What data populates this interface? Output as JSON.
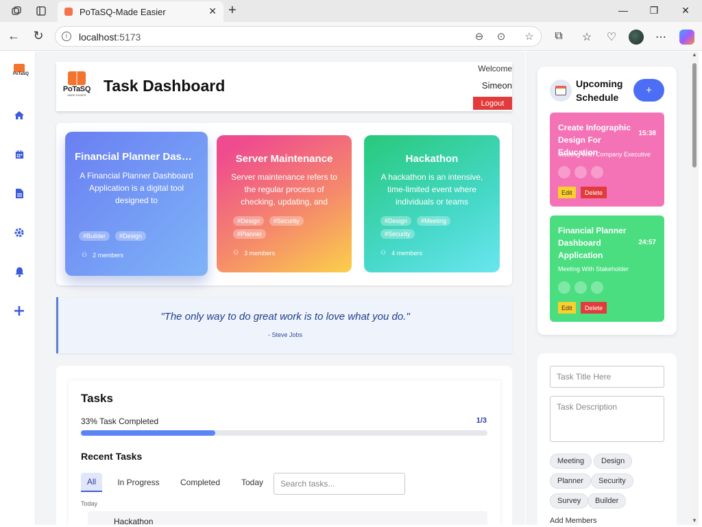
{
  "browser": {
    "tab_title": "PoTaSQ-Made Easier",
    "url_host": "localhost",
    "url_port": ":5173"
  },
  "header": {
    "logo_name": "PoTaSQ",
    "logo_tagline": "MADE EASIER",
    "title": "Task Dashboard",
    "welcome": "Welcome",
    "username": "Simeon",
    "logout_label": "Logout"
  },
  "projects": [
    {
      "title": "Financial Planner Dashboard Application",
      "description": "A Financial Planner Dashboard Application is a digital tool designed to",
      "tags": [
        "#Builder",
        "#Design"
      ],
      "members": "2 members"
    },
    {
      "title": "Server Maintenance",
      "description": "Server maintenance refers to the regular process of checking, updating, and",
      "tags": [
        "#Design",
        "#Security",
        "#Planner"
      ],
      "members": "3 members"
    },
    {
      "title": "Hackathon",
      "description": "A hackathon is an intensive, time-limited event where individuals or teams",
      "tags": [
        "#Design",
        "#Meeting",
        "#Security"
      ],
      "members": "4 members"
    }
  ],
  "quote": {
    "text": "\"The only way to do great work is to love what you do.\"",
    "author": "- Steve Jobs"
  },
  "tasks": {
    "title": "Tasks",
    "progress_label": "33% Task Completed",
    "progress_fraction": 0.33,
    "progress_count": "1/3",
    "recent_title": "Recent Tasks",
    "filters": [
      "All",
      "In Progress",
      "Completed",
      "Today"
    ],
    "active_filter": "All",
    "search_placeholder": "Search tasks...",
    "group_label": "Today",
    "rows": [
      {
        "title": "Hackathon"
      }
    ]
  },
  "schedule": {
    "title": "Upcoming Schedule",
    "add_label": "+",
    "items": [
      {
        "title": "Create Infographic Design For Education",
        "time": "15:38",
        "subtitle": "Meeting With Company Executive",
        "edit_label": "Edit",
        "delete_label": "Delete",
        "color": "#f472b6"
      },
      {
        "title": "Financial Planner Dashboard Application",
        "time": "24:57",
        "subtitle": "Meeting With Stakeholder",
        "edit_label": "Edit",
        "delete_label": "Delete",
        "color": "#4ade80"
      }
    ]
  },
  "task_form": {
    "title_placeholder": "Task Title Here",
    "description_placeholder": "Task Description",
    "tag_options": [
      "Meeting",
      "Design",
      "Planner",
      "Security",
      "Survey",
      "Builder"
    ],
    "add_members_label": "Add Members"
  },
  "sidebar": {
    "logo_name": "PoTaSQ",
    "icons": [
      "home-icon",
      "calendar-icon",
      "document-icon",
      "settings-icon",
      "bell-icon",
      "plus-icon"
    ]
  },
  "colors": {
    "accent": "#4c6ef5",
    "danger": "#e23b3b",
    "card1": "#6d8cf5",
    "card2": "#f24f8a",
    "card3": "#2bcf8a"
  }
}
